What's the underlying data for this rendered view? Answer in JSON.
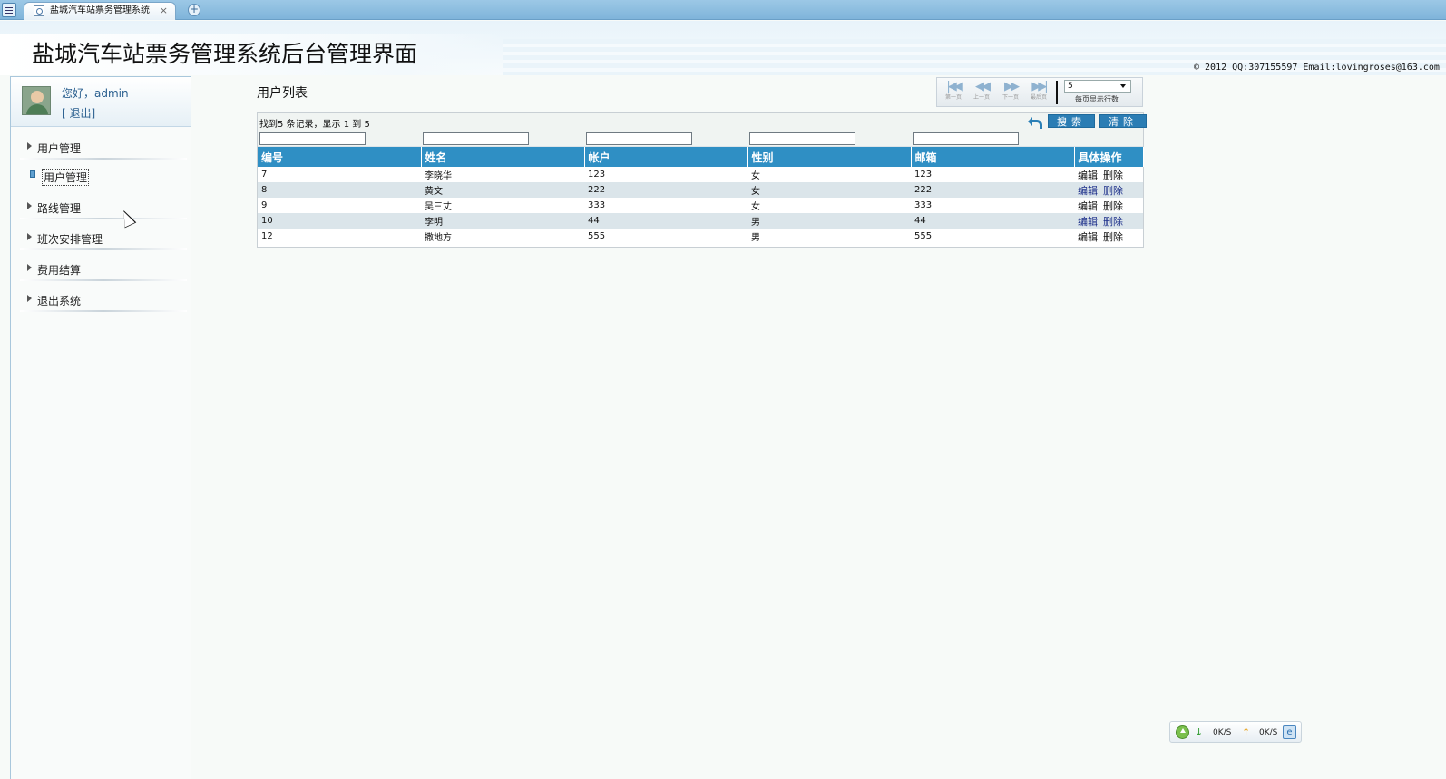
{
  "browser": {
    "tab_title": "盐城汽车站票务管理系统",
    "tab_close": "×",
    "new_tab": "+"
  },
  "header": {
    "title": "盐城汽车站票务管理系统后台管理界面",
    "copyright": "© 2012 QQ:307155597 Email:lovingroses@163.com"
  },
  "sidebar": {
    "greeting": "您好，admin",
    "logout": "[ 退出]",
    "menu": [
      {
        "label": "用户管理"
      },
      {
        "label": "用户管理",
        "sub": true
      },
      {
        "label": "路线管理"
      },
      {
        "label": "班次安排管理"
      },
      {
        "label": "费用结算"
      },
      {
        "label": "退出系统"
      }
    ]
  },
  "main": {
    "title": "用户列表",
    "pager": {
      "first": "第一页",
      "prev": "上一页",
      "next": "下一页",
      "last": "最后页",
      "page_size": "5",
      "page_size_label": "每页显示行数"
    },
    "toolbar": {
      "found_text": "找到5 条记录，显示 1 到 5",
      "search": "搜索",
      "clear": "清除"
    },
    "columns": [
      "编号",
      "姓名",
      "帐户",
      "性别",
      "邮箱",
      "具体操作"
    ],
    "rows": [
      {
        "id": "7",
        "name": "李晓华",
        "account": "123",
        "gender": "女",
        "email": "123",
        "edit": "编辑",
        "delete": "删除"
      },
      {
        "id": "8",
        "name": "黄文",
        "account": "222",
        "gender": "女",
        "email": "222",
        "edit": "编辑",
        "delete": "删除"
      },
      {
        "id": "9",
        "name": "吴三丈",
        "account": "333",
        "gender": "女",
        "email": "333",
        "edit": "编辑",
        "delete": "删除"
      },
      {
        "id": "10",
        "name": "李明",
        "account": "44",
        "gender": "男",
        "email": "44",
        "edit": "编辑",
        "delete": "删除"
      },
      {
        "id": "12",
        "name": "撒地方",
        "account": "555",
        "gender": "男",
        "email": "555",
        "edit": "编辑",
        "delete": "删除"
      }
    ]
  },
  "speed_widget": {
    "down": "0K/S",
    "up": "0K/S"
  },
  "colors": {
    "header_blue": "#2f8fc4",
    "alt_row": "#dbe5ea",
    "link": "#2a5f8f"
  }
}
